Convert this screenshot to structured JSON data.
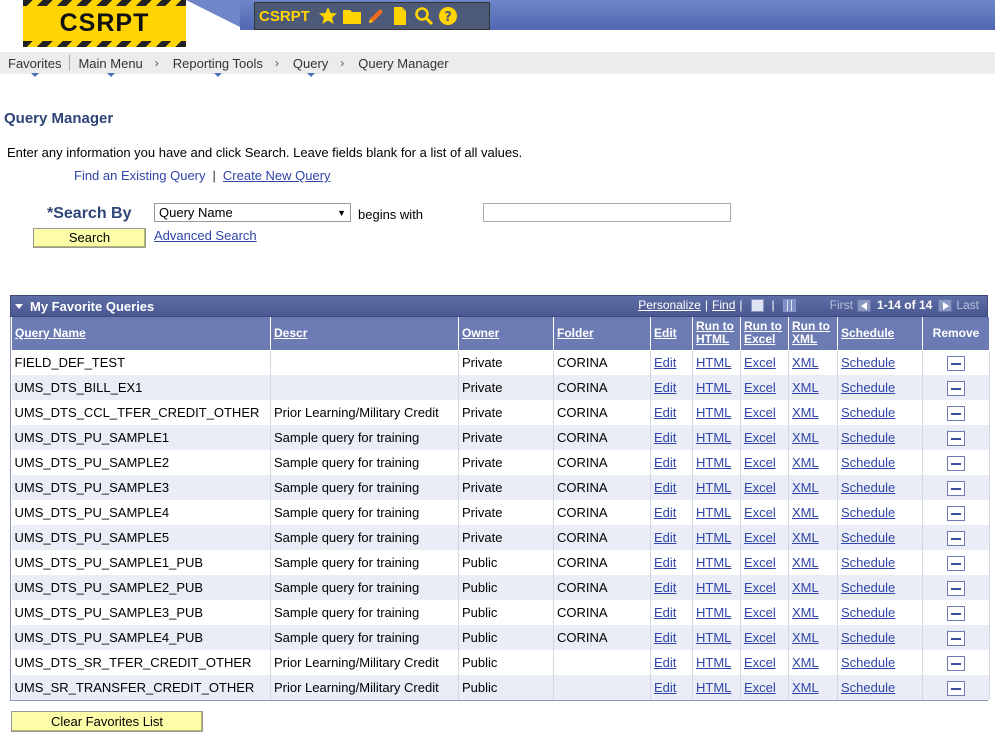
{
  "banner": {
    "logo_text": "CSRPT",
    "toolbar_title": "CSRPT"
  },
  "toolbar_icons": [
    "star-icon",
    "folder-icon",
    "pencil-icon",
    "document-icon",
    "search-icon",
    "help-icon"
  ],
  "colors": {
    "banner_blue": "#5f76bd",
    "toolbar_yellow": "#ffd400",
    "grid_header": "#4e5c94",
    "button_yellow": "#fdfda9",
    "link_blue": "#2f45a8"
  },
  "nav": {
    "favorites": "Favorites",
    "main_menu": "Main Menu",
    "reporting_tools": "Reporting Tools",
    "query": "Query",
    "query_manager": "Query Manager"
  },
  "page": {
    "title": "Query Manager",
    "instructions": "Enter any information you have and click Search. Leave fields blank for a list of all values.",
    "find_existing": "Find an Existing Query",
    "create_new": "Create New Query"
  },
  "search": {
    "label": "*Search By",
    "field_selected": "Query Name",
    "operator": "begins with",
    "value": "",
    "search_button": "Search",
    "advanced_link": "Advanced Search"
  },
  "grid": {
    "title": "My Favorite Queries",
    "personalize": "Personalize",
    "find": "Find",
    "first": "First",
    "count": "1-14 of 14",
    "last": "Last",
    "columns": {
      "query_name": "Query Name",
      "descr": "Descr",
      "owner": "Owner",
      "folder": "Folder",
      "edit": "Edit",
      "run_html_1": "Run to",
      "run_html_2": "HTML",
      "run_excel_1": "Run to",
      "run_excel_2": "Excel",
      "run_xml_1": "Run to",
      "run_xml_2": "XML",
      "schedule": "Schedule",
      "remove": "Remove"
    },
    "link_labels": {
      "edit": "Edit",
      "html": "HTML",
      "excel": "Excel",
      "xml": "XML",
      "schedule": "Schedule"
    },
    "rows": [
      {
        "name": "FIELD_DEF_TEST",
        "descr": "",
        "owner": "Private",
        "folder": "CORINA"
      },
      {
        "name": "UMS_DTS_BILL_EX1",
        "descr": "",
        "owner": "Private",
        "folder": "CORINA"
      },
      {
        "name": "UMS_DTS_CCL_TFER_CREDIT_OTHER",
        "descr": "Prior Learning/Military Credit",
        "owner": "Private",
        "folder": "CORINA"
      },
      {
        "name": "UMS_DTS_PU_SAMPLE1",
        "descr": "Sample query for training",
        "owner": "Private",
        "folder": "CORINA"
      },
      {
        "name": "UMS_DTS_PU_SAMPLE2",
        "descr": "Sample query for training",
        "owner": "Private",
        "folder": "CORINA"
      },
      {
        "name": "UMS_DTS_PU_SAMPLE3",
        "descr": "Sample query for training",
        "owner": "Private",
        "folder": "CORINA"
      },
      {
        "name": "UMS_DTS_PU_SAMPLE4",
        "descr": "Sample query for training",
        "owner": "Private",
        "folder": "CORINA"
      },
      {
        "name": "UMS_DTS_PU_SAMPLE5",
        "descr": "Sample query for training",
        "owner": "Private",
        "folder": "CORINA"
      },
      {
        "name": "UMS_DTS_PU_SAMPLE1_PUB",
        "descr": "Sample query for training",
        "owner": "Public",
        "folder": "CORINA"
      },
      {
        "name": "UMS_DTS_PU_SAMPLE2_PUB",
        "descr": "Sample query for training",
        "owner": "Public",
        "folder": "CORINA"
      },
      {
        "name": "UMS_DTS_PU_SAMPLE3_PUB",
        "descr": "Sample query for training",
        "owner": "Public",
        "folder": "CORINA"
      },
      {
        "name": "UMS_DTS_PU_SAMPLE4_PUB",
        "descr": "Sample query for training",
        "owner": "Public",
        "folder": "CORINA"
      },
      {
        "name": "UMS_DTS_SR_TFER_CREDIT_OTHER",
        "descr": "Prior Learning/Military Credit",
        "owner": "Public",
        "folder": ""
      },
      {
        "name": "UMS_SR_TRANSFER_CREDIT_OTHER",
        "descr": "Prior Learning/Military Credit",
        "owner": "Public",
        "folder": ""
      }
    ]
  },
  "footer": {
    "clear_button": "Clear Favorites List"
  }
}
